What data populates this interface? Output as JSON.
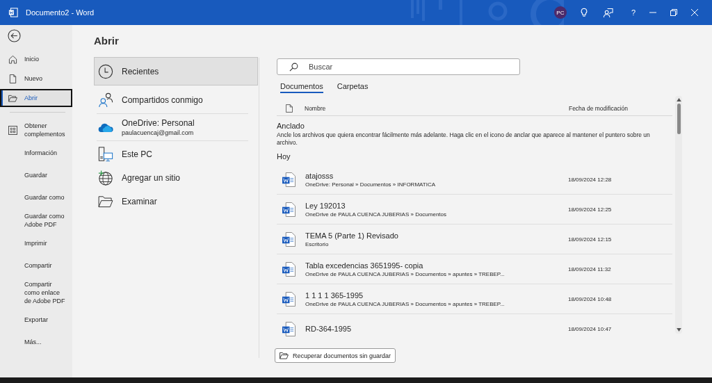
{
  "window": {
    "title": "Documento2  -  Word",
    "avatar_initials": "PC",
    "help": "?"
  },
  "sidebar": {
    "items": [
      {
        "label": "Inicio",
        "kind": "home",
        "selected": false
      },
      {
        "label": "Nuevo",
        "kind": "document",
        "selected": false
      },
      {
        "label": "Abrir",
        "kind": "folder",
        "selected": true
      },
      {
        "label": "Obtener complementos",
        "kind": "grid",
        "selected": false
      },
      {
        "label": "Información",
        "kind": "text",
        "selected": false
      },
      {
        "label": "Guardar",
        "kind": "text",
        "selected": false
      },
      {
        "label": "Guardar como",
        "kind": "text",
        "selected": false
      },
      {
        "label": "Guardar como Adobe PDF",
        "kind": "text",
        "selected": false
      },
      {
        "label": "Imprimir",
        "kind": "text",
        "selected": false
      },
      {
        "label": "Compartir",
        "kind": "text",
        "selected": false
      },
      {
        "label": "Compartir como enlace de Adobe PDF",
        "kind": "text",
        "selected": false
      },
      {
        "label": "Exportar",
        "kind": "text",
        "selected": false
      },
      {
        "label": "Más...",
        "kind": "text",
        "selected": false
      }
    ]
  },
  "heading": "Abrir",
  "places": [
    {
      "label": "Recientes",
      "kind": "clock",
      "selected": true
    },
    {
      "label": "Compartidos conmigo",
      "kind": "people",
      "selected": false
    },
    {
      "label": "OneDrive: Personal",
      "detail": "paulacuencaj@gmail.com",
      "kind": "cloud",
      "selected": false
    },
    {
      "label": "Este PC",
      "kind": "pc",
      "selected": false
    },
    {
      "label": "Agregar un sitio",
      "kind": "globe",
      "selected": false
    },
    {
      "label": "Examinar",
      "kind": "folder",
      "selected": false
    }
  ],
  "search": {
    "placeholder": "Buscar"
  },
  "tabs": [
    {
      "label": "Documentos",
      "selected": true
    },
    {
      "label": "Carpetas",
      "selected": false
    }
  ],
  "file_list": {
    "columns": [
      "Nombre",
      "Fecha de modificación"
    ],
    "pinned": {
      "title": "Anclado",
      "note": "Ancle los archivos que quiera encontrar fácilmente más adelante. Haga clic en el icono de anclar que aparece al mantener el puntero sobre un archivo."
    },
    "today": {
      "title": "Hoy",
      "files": [
        {
          "name": "atajosss",
          "location": "OneDrive: Personal » Documentos » INFORMATICA",
          "modified": "18/09/2024 12:28"
        },
        {
          "name": "Ley 192013",
          "location": "OneDrive de PAULA CUENCA JUBERIAS » Documentos",
          "modified": "18/09/2024 12:25"
        },
        {
          "name": "TEMA 5 (Parte 1) Revisado",
          "location": "Escritorio",
          "modified": "18/09/2024 12:15"
        },
        {
          "name": "Tabla excedencias 3651995- copia",
          "location": "OneDrive de PAULA CUENCA JUBERIAS » Documentos » apuntes » TREBEP...",
          "modified": "18/09/2024 11:32"
        },
        {
          "name": "1 1 1 1 365-1995",
          "location": "OneDrive de PAULA CUENCA JUBERIAS » Documentos » apuntes » TREBEP...",
          "modified": "18/09/2024 10:48"
        },
        {
          "name": "RD-364-1995",
          "modified": "18/09/2024 10:47"
        }
      ]
    }
  },
  "recover_button": "Recuperar documentos sin guardar"
}
